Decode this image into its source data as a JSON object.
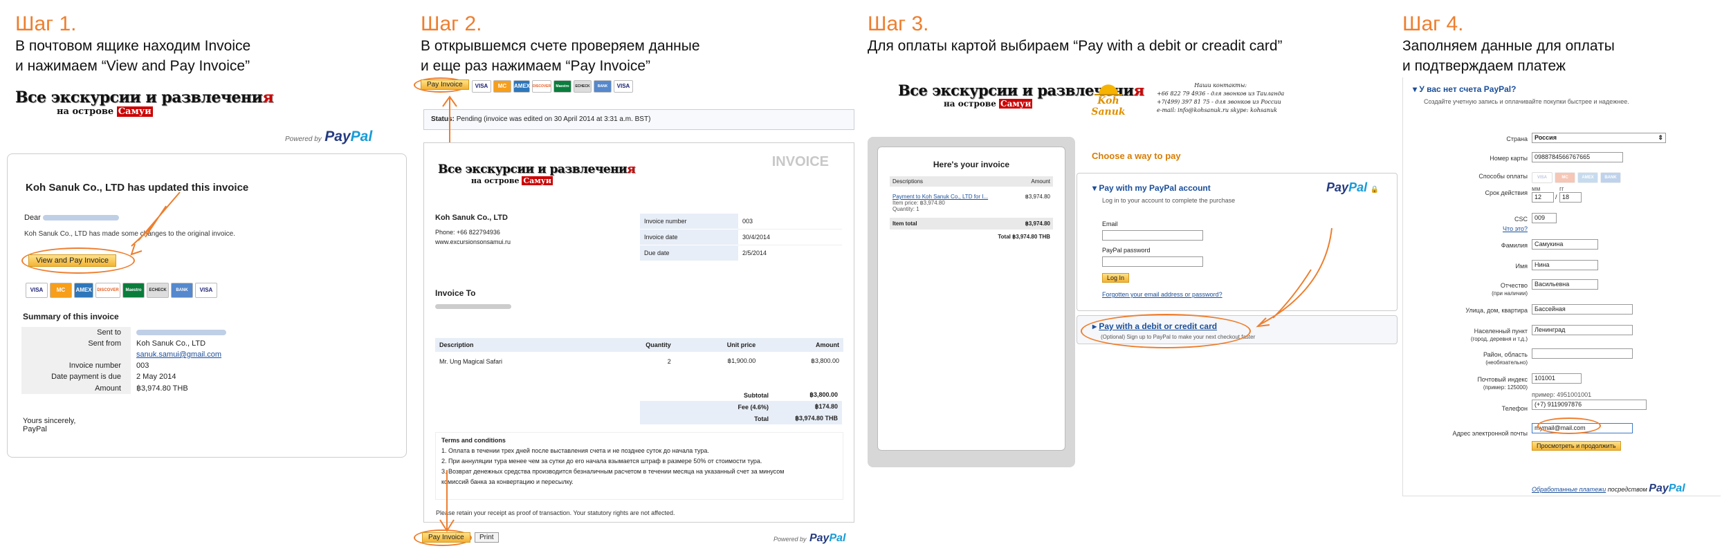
{
  "steps": [
    {
      "title": "Шаг 1.",
      "line1": "В почтовом ящике находим Invoice",
      "line2": "и нажимаем “View and Pay Invoice”"
    },
    {
      "title": "Шаг 2.",
      "line1": "В открывшемся счете проверяем данные",
      "line2": "и еще раз нажимаем “Pay Invoice”"
    },
    {
      "title": "Шаг 3.",
      "line1": "Для оплаты картой выбираем “Pay with a debit or creadit card”"
    },
    {
      "title": "Шаг 4.",
      "line1": "Заполняем данные для оплаты",
      "line2": "и подтверждаем платеж"
    }
  ],
  "logo": {
    "top": "Все экскурсии и развлечени",
    "top_red": "я",
    "sub": "на острове ",
    "sub_red": "Самуи"
  },
  "paypal": {
    "powered": "Powered by",
    "pay": "Pay",
    "pal": "Pal"
  },
  "cards": [
    "VISA",
    "MC",
    "AMEX",
    "DISCOVER",
    "Maestro",
    "ECHECK",
    "BANK",
    "VISA"
  ],
  "email": {
    "heading": "Koh Sanuk Co., LTD has updated this invoice",
    "dear": "Dear",
    "body": "Koh Sanuk Co., LTD has made some changes to the original invoice.",
    "button": "View and Pay Invoice",
    "summary_title": "Summary of this invoice",
    "rows": [
      {
        "k": "Sent to",
        "v": ""
      },
      {
        "k": "Sent from",
        "v": "Koh Sanuk Co., LTD"
      },
      {
        "k": "",
        "v": "sanuk.samui@gmail.com"
      },
      {
        "k": "Invoice number",
        "v": "003"
      },
      {
        "k": "Date payment is due",
        "v": "2 May 2014"
      },
      {
        "k": "Amount",
        "v": "฿3,974.80 THB"
      }
    ],
    "sign1": "Yours sincerely,",
    "sign2": "PayPal"
  },
  "invoice": {
    "pay_button": "Pay Invoice",
    "status_label": "Status:",
    "status_text": "Pending (invoice was edited on 30 April 2014 at 3:31 a.m. BST)",
    "label": "INVOICE",
    "company": "Koh Sanuk Co., LTD",
    "phone": "Phone: +66 822794936",
    "site": "www.excursionsonsamui.ru",
    "meta": [
      {
        "k": "Invoice number",
        "v": "003"
      },
      {
        "k": "Invoice date",
        "v": "30/4/2014"
      },
      {
        "k": "Due date",
        "v": "2/5/2014"
      }
    ],
    "invoice_to": "Invoice To",
    "cols": [
      "Description",
      "Quantity",
      "Unit price",
      "Amount"
    ],
    "item": {
      "desc": "Mr. Ung Magical Safari",
      "qty": "2",
      "price": "฿1,900.00",
      "amount": "฿3,800.00"
    },
    "totals": [
      {
        "k": "Subtotal",
        "v": "฿3,800.00"
      },
      {
        "k": "Fee (4.6%)",
        "v": "฿174.80"
      },
      {
        "k": "Total",
        "v": "฿3,974.80 THB"
      }
    ],
    "terms_title": "Terms and conditions",
    "terms": [
      "1. Оплата в течении трех дней после выставления счета и не позднее суток до начала тура.",
      "2. При аннуляции тура менее чем за сутки до его начала взымается штраф в размере 50% от стоимости тура.",
      "3. Возврат денежных средства производится безналичным расчетом в течении месяца на указанный счет за минусом",
      "комиссий банка за конвертацию и пересылку."
    ],
    "retain": "Please retain your receipt as proof of transaction. Your statutory rights are not affected.",
    "print": "Print"
  },
  "choose": {
    "contacts": [
      "Наши контакты:",
      "+66 822 79 4936 - для звонков из Таиланда",
      "+7(499) 397 81 75 - для звонков из России",
      "e-mail: info@kohsanuk.ru  skype: kohsanuk"
    ],
    "logo2": "Koh Sanuk",
    "heres": "Here's your invoice",
    "desc_col": "Descriptions",
    "amt_col": "Amount",
    "item_link": "Payment to Koh Sanuk Co., LTD for I...",
    "item_amt": "฿3,974.80",
    "item_price": "Item price: ฿3,974.80",
    "item_qty": "Quantity: 1",
    "item_total_label": "Item total",
    "item_total": "฿3,974.80",
    "total": "Total ฿3,974.80 THB",
    "choose_title": "Choose a way to pay",
    "pp_account": "Pay with my PayPal account",
    "pp_login": "Log in to your account to complete the purchase",
    "email_label": "Email",
    "pw_label": "PayPal password",
    "login_btn": "Log In",
    "forgot": "Forgotten your email address or password?",
    "card_title": "Pay with a debit or credit card",
    "card_sub": "(Optional) Sign up to PayPal to make your next checkout faster"
  },
  "form": {
    "no_account": "У вас нет счета PayPal?",
    "create": "Создайте учетную запись и оплачивайте покупки быстрее и надежнее.",
    "fields": [
      {
        "label": "Страна",
        "value": "Россия"
      },
      {
        "label": "Номер карты",
        "value": "0988784566767665"
      },
      {
        "label": "Способы оплаты",
        "value": ""
      },
      {
        "label": "Срок действия",
        "value": ""
      },
      {
        "label": "CSC",
        "value": "009"
      },
      {
        "label": "Фамилия",
        "value": "Самукина"
      },
      {
        "label": "Имя",
        "value": "Нина"
      },
      {
        "label": "Отчество",
        "value": "Васильевна"
      },
      {
        "label": "Улица, дом, квартира",
        "value": "Бассейная"
      },
      {
        "label": "Населенный пункт",
        "value": "Ленинград"
      },
      {
        "label": "Район, область",
        "value": ""
      },
      {
        "label": "Почтовый индекс",
        "value": "101001"
      },
      {
        "label": "Телефон",
        "value": "(+7) 9119097876"
      },
      {
        "label": "Адрес электронной почты",
        "value": "mymail@mail.com"
      }
    ],
    "sub_labels": {
      "csc_what": "Что это?",
      "patronymic": "(при наличии)",
      "city": "(город, деревня и т.д.)",
      "district": "(необязательно)",
      "zip": "(пример: 125000)",
      "phone_example": "пример: 4951001001"
    },
    "exp_mm_label": "мм",
    "exp_yy_label": "гг",
    "exp_mm": "12",
    "exp_yy": "18",
    "exp_sep": "/",
    "submit": "Просмотреть и продолжить",
    "processed": "Обработанные платежи",
    "via": "посредством"
  }
}
